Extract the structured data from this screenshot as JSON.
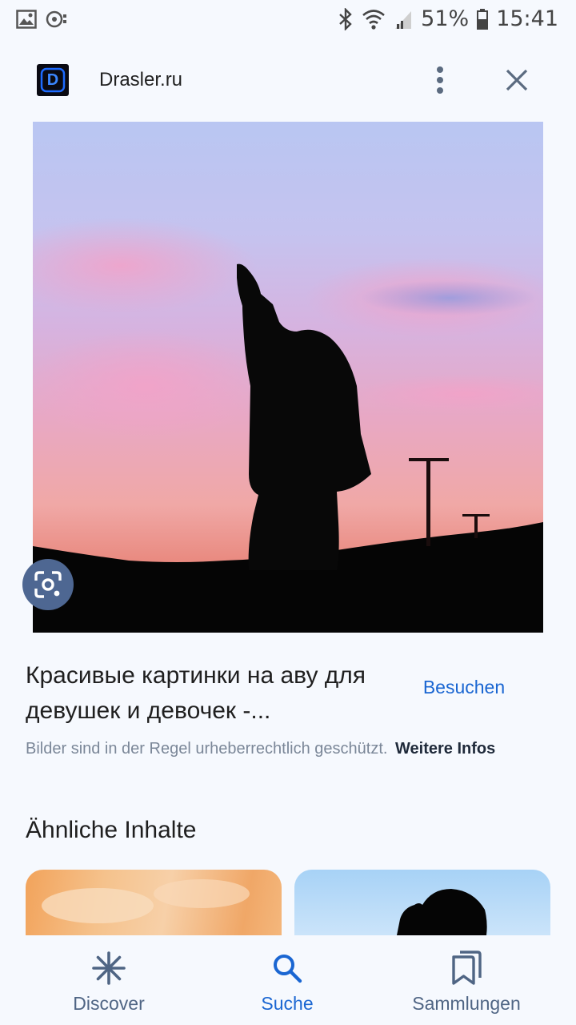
{
  "status_bar": {
    "battery": "51%",
    "time": "15:41",
    "icons": [
      "gallery-icon",
      "cast-icon",
      "bluetooth-icon",
      "wifi-icon",
      "signal-icon",
      "battery-icon"
    ]
  },
  "header": {
    "logo_letter": "D",
    "site_name": "Drasler.ru",
    "icons": [
      "more-vert-icon",
      "close-icon"
    ]
  },
  "result": {
    "title": "Красивые картинки на аву для девушек и девочек -...",
    "visit_label": "Besuchen",
    "copyright_text": "Bilder sind in der Regel urheberrechtlich geschützt.",
    "more_info_label": "Weitere Infos"
  },
  "similar": {
    "heading": "Ähnliche Inhalte"
  },
  "bottom_nav": {
    "items": [
      {
        "label": "Discover",
        "icon": "asterisk-icon",
        "active": false
      },
      {
        "label": "Suche",
        "icon": "search-icon",
        "active": true
      },
      {
        "label": "Sammlungen",
        "icon": "bookmarks-icon",
        "active": false
      }
    ]
  },
  "colors": {
    "accent": "#1a66d2",
    "background": "#f6f9fe",
    "lens_button": "#4e6792"
  }
}
